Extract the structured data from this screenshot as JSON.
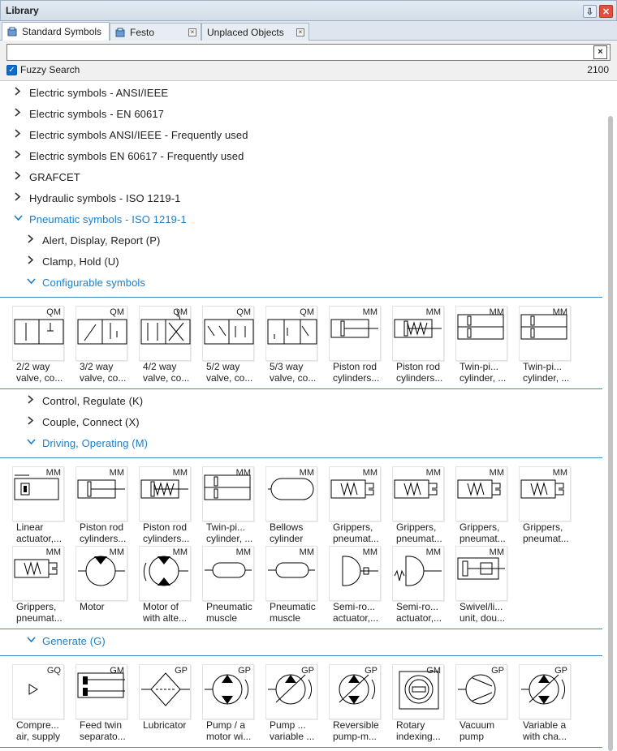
{
  "window": {
    "title": "Library",
    "pin_icon": "pin-icon",
    "close_icon": "close-icon"
  },
  "tabs": [
    {
      "label": "Standard Symbols",
      "active": true,
      "icon": "library-icon"
    },
    {
      "label": "Festo",
      "active": false,
      "icon": "library-icon"
    },
    {
      "label": "Unplaced Objects",
      "active": false
    }
  ],
  "search": {
    "value": "",
    "placeholder": "",
    "clear_label": "×",
    "fuzzy_label": "Fuzzy Search",
    "fuzzy_checked": true,
    "result_count": "2100"
  },
  "tree": [
    {
      "label": "Electric symbols - ANSI/IEEE",
      "level": 0,
      "expanded": false
    },
    {
      "label": "Electric symbols - EN 60617",
      "level": 0,
      "expanded": false
    },
    {
      "label": "Electric symbols ANSI/IEEE - Frequently used",
      "level": 0,
      "expanded": false
    },
    {
      "label": "Electric symbols EN 60617 - Frequently used",
      "level": 0,
      "expanded": false
    },
    {
      "label": "GRAFCET",
      "level": 0,
      "expanded": false
    },
    {
      "label": "Hydraulic symbols - ISO 1219-1",
      "level": 0,
      "expanded": false
    },
    {
      "label": "Pneumatic symbols - ISO 1219-1",
      "level": 0,
      "expanded": true
    },
    {
      "label": "Alert, Display, Report (P)",
      "level": 1,
      "expanded": false
    },
    {
      "label": "Clamp, Hold (U)",
      "level": 1,
      "expanded": false
    },
    {
      "label": "Configurable symbols",
      "level": 1,
      "expanded": true
    },
    {
      "label": "Control, Regulate (K)",
      "level": 1,
      "expanded": false
    },
    {
      "label": "Couple, Connect (X)",
      "level": 1,
      "expanded": false
    },
    {
      "label": "Driving, Operating (M)",
      "level": 1,
      "expanded": true
    },
    {
      "label": "Generate (G)",
      "level": 1,
      "expanded": true
    }
  ],
  "groups": {
    "configurable": [
      {
        "code": "QM",
        "line1": "2/2 way",
        "line2": "valve, co...",
        "icon": "valve-2-2-icon"
      },
      {
        "code": "QM",
        "line1": "3/2 way",
        "line2": "valve, co...",
        "icon": "valve-3-2-icon"
      },
      {
        "code": "QM",
        "line1": "4/2 way",
        "line2": "valve, co...",
        "icon": "valve-4-2-icon"
      },
      {
        "code": "QM",
        "line1": "5/2 way",
        "line2": "valve, co...",
        "icon": "valve-5-2-icon"
      },
      {
        "code": "QM",
        "line1": "5/3 way",
        "line2": "valve, co...",
        "icon": "valve-5-3-icon"
      },
      {
        "code": "MM",
        "line1": "Piston rod",
        "line2": "cylinders...",
        "icon": "piston-cylinder-icon"
      },
      {
        "code": "MM",
        "line1": "Piston rod",
        "line2": "cylinders...",
        "icon": "spring-cylinder-icon"
      },
      {
        "code": "MM",
        "line1": "Twin-pi...",
        "line2": "cylinder, ...",
        "icon": "twin-piston-icon"
      },
      {
        "code": "MM",
        "line1": "Twin-pi...",
        "line2": "cylinder, ...",
        "icon": "twin-piston-icon"
      }
    ],
    "driving": [
      {
        "code": "MM",
        "line1": "Linear",
        "line2": "actuator,...",
        "icon": "linear-actuator-icon"
      },
      {
        "code": "MM",
        "line1": "Piston rod",
        "line2": "cylinders...",
        "icon": "piston-cylinder-icon"
      },
      {
        "code": "MM",
        "line1": "Piston rod",
        "line2": "cylinders...",
        "icon": "spring-cylinder-icon"
      },
      {
        "code": "MM",
        "line1": "Twin-pi...",
        "line2": "cylinder, ...",
        "icon": "twin-piston-icon"
      },
      {
        "code": "MM",
        "line1": "Bellows",
        "line2": "cylinder",
        "icon": "bellows-icon"
      },
      {
        "code": "MM",
        "line1": "Grippers,",
        "line2": "pneumat...",
        "icon": "gripper-icon"
      },
      {
        "code": "MM",
        "line1": "Grippers,",
        "line2": "pneumat...",
        "icon": "gripper-icon"
      },
      {
        "code": "MM",
        "line1": "Grippers,",
        "line2": "pneumat...",
        "icon": "gripper-icon"
      },
      {
        "code": "MM",
        "line1": "Grippers,",
        "line2": "pneumat...",
        "icon": "gripper-icon"
      },
      {
        "code": "MM",
        "line1": "Grippers,",
        "line2": "pneumat...",
        "icon": "gripper-icon"
      },
      {
        "code": "MM",
        "line1": "Motor",
        "line2": "",
        "icon": "motor-icon"
      },
      {
        "code": "MM",
        "line1": "Motor of",
        "line2": "with alte...",
        "icon": "motor-alt-icon"
      },
      {
        "code": "MM",
        "line1": "Pneumatic",
        "line2": "muscle",
        "icon": "muscle-icon"
      },
      {
        "code": "MM",
        "line1": "Pneumatic",
        "line2": "muscle",
        "icon": "muscle-icon"
      },
      {
        "code": "MM",
        "line1": "Semi-ro...",
        "line2": "actuator,...",
        "icon": "semi-rotary-icon"
      },
      {
        "code": "MM",
        "line1": "Semi-ro...",
        "line2": "actuator,...",
        "icon": "semi-rotary-spring-icon"
      },
      {
        "code": "MM",
        "line1": "Swivel/li...",
        "line2": "unit, dou...",
        "icon": "swivel-unit-icon"
      }
    ],
    "generate": [
      {
        "code": "GQ",
        "line1": "Compre...",
        "line2": "air, supply",
        "icon": "air-supply-icon"
      },
      {
        "code": "GM",
        "line1": "Feed twin",
        "line2": "separato...",
        "icon": "feed-separator-icon"
      },
      {
        "code": "GP",
        "line1": "Lubricator",
        "line2": "",
        "icon": "lubricator-icon"
      },
      {
        "code": "GP",
        "line1": "Pump / a",
        "line2": "motor wi...",
        "icon": "pump-motor-icon"
      },
      {
        "code": "GP",
        "line1": "Pump ...",
        "line2": "variable ...",
        "icon": "variable-pump-icon"
      },
      {
        "code": "GP",
        "line1": "Reversible",
        "line2": "pump-m...",
        "icon": "reversible-pump-icon"
      },
      {
        "code": "GM",
        "line1": "Rotary",
        "line2": "indexing...",
        "icon": "rotary-indexing-icon"
      },
      {
        "code": "GP",
        "line1": "Vacuum",
        "line2": "pump",
        "icon": "vacuum-pump-icon"
      },
      {
        "code": "GP",
        "line1": "Variable a",
        "line2": "with cha...",
        "icon": "variable-change-icon"
      }
    ]
  }
}
